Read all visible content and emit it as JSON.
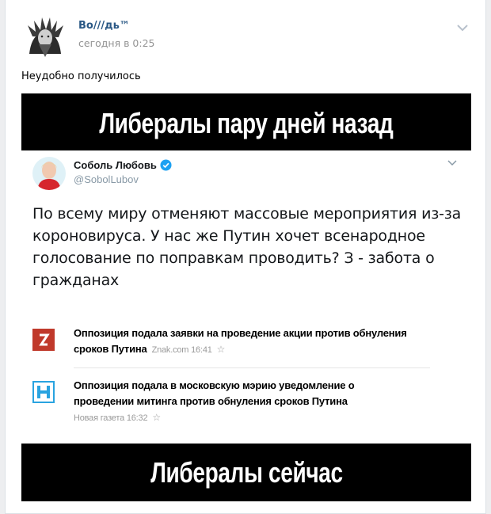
{
  "post": {
    "author": "Во///дь™",
    "time": "сегодня в 0:25",
    "text": "Неудобно получилось"
  },
  "meme": {
    "top_caption": "Либералы пару дней назад",
    "bottom_caption": "Либералы сейчас",
    "tweet": {
      "name": "Соболь Любовь",
      "handle": "@SobolLubov",
      "text": "По всему миру отменяют массовые мероприятия из-за короновируса. У нас же Путин хочет всенародное голосование по поправкам проводить? З - забота о гражданах"
    },
    "news": [
      {
        "headline": "Оппозиция подала заявки на проведение акции против обнуления сроков Путина",
        "source": "Znak.com 16:41",
        "logo_color": "#c0392b"
      },
      {
        "headline": "Оппозиция подала в московскую мэрию уведомление о проведении митинга против обнуления сроков Путина",
        "source": "Новая газета 16:32",
        "logo_color": "#29a3e0"
      }
    ]
  },
  "colors": {
    "link": "#2a5885",
    "meta": "#939393",
    "verified": "#1da1f2"
  },
  "icons": [
    "chevron-down-icon",
    "verified-icon",
    "star-icon"
  ]
}
